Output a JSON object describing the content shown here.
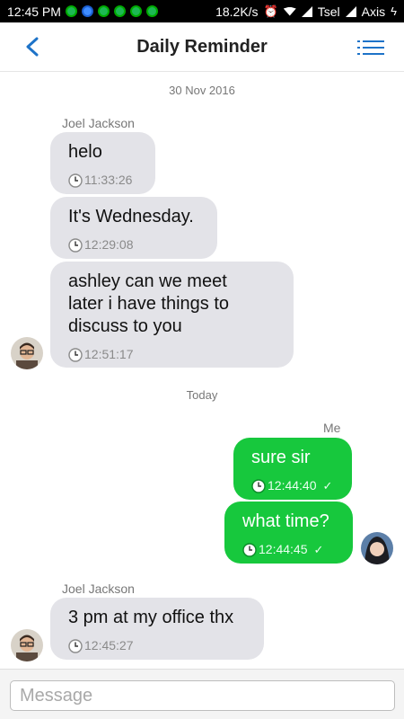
{
  "status_bar": {
    "time": "12:45 PM",
    "speed": "18.2K/s",
    "carrier1": "Tsel",
    "carrier2": "Axis"
  },
  "header": {
    "title": "Daily Reminder",
    "back_icon": "chevron-left-icon",
    "menu_icon": "list-menu-icon",
    "accent_color": "#1e73c8"
  },
  "conversation": {
    "day1": "30 Nov 2016",
    "day2": "Today",
    "sender_other": "Joel Jackson",
    "sender_me": "Me",
    "messages": [
      {
        "from": "Joel Jackson",
        "text": "helo",
        "time": "11:33:26"
      },
      {
        "from": "Joel Jackson",
        "text": "It's Wednesday.",
        "time": "12:29:08"
      },
      {
        "from": "Joel Jackson",
        "text": "ashley can we meet later i have things to discuss to you",
        "line1": "ashley can we meet",
        "line2": "later i have things to",
        "line3": "discuss to you",
        "time": "12:51:17"
      },
      {
        "from": "Me",
        "text": "sure sir",
        "time": "12:44:40"
      },
      {
        "from": "Me",
        "text": "what time?",
        "time": "12:44:45"
      },
      {
        "from": "Joel Jackson",
        "text": "3 pm at my office thx",
        "time": "12:45:27"
      }
    ],
    "incoming_color": "#e3e3e8",
    "outgoing_color": "#17c83d"
  },
  "composer": {
    "placeholder": "Message"
  }
}
